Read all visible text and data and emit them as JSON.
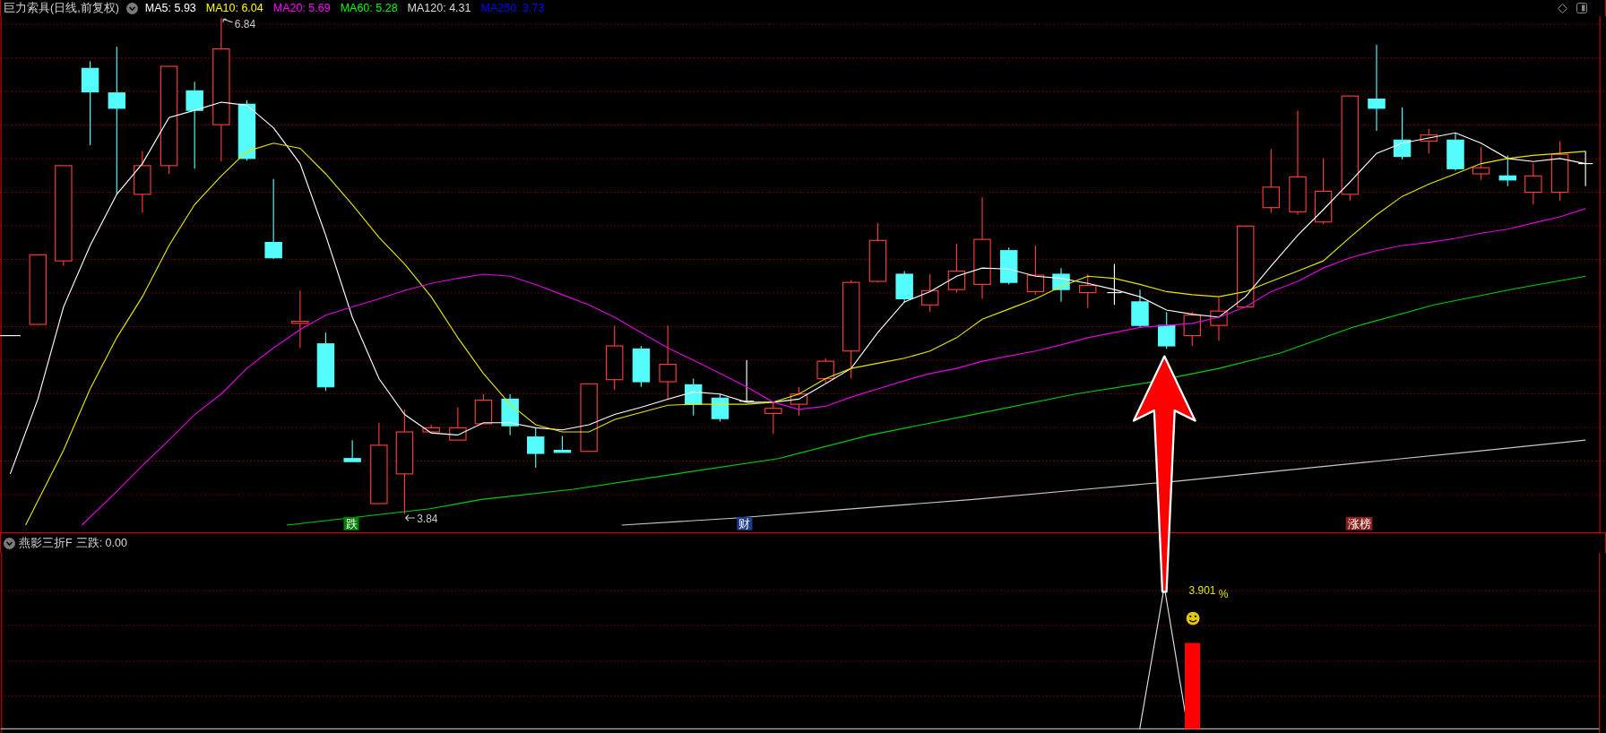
{
  "header": {
    "title": "巨力索具(日线,前复权)",
    "ma": [
      {
        "label": "MA5: 5.93",
        "color": "#ffffff"
      },
      {
        "label": "MA10: 6.04",
        "color": "#ffff00"
      },
      {
        "label": "MA20: 5.69",
        "color": "#ff00ff"
      },
      {
        "label": "MA60: 5.28",
        "color": "#00ff00"
      },
      {
        "label": "MA120: 4.31",
        "color": "#dcdcdc"
      },
      {
        "label": "MA250: 3.73",
        "color": "#0000ff"
      }
    ]
  },
  "main_chart": {
    "high_label": "6.84",
    "low_label": "3.84",
    "markers": [
      {
        "text": "跌",
        "color": "#008000"
      },
      {
        "text": "财",
        "color": "#203c8c"
      },
      {
        "text": "涨榜",
        "color": "#8c1e1e"
      }
    ]
  },
  "sub_panel": {
    "title": "燕影三折F",
    "reading": "三跌: 0.00",
    "value_label": "3.901",
    "unit": "%"
  }
}
